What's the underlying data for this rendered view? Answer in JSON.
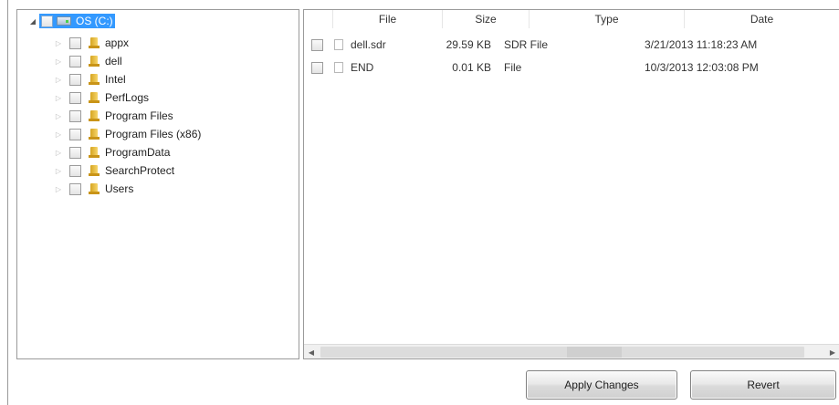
{
  "tree": {
    "root_label": "OS (C:)",
    "folders": [
      "appx",
      "dell",
      "Intel",
      "PerfLogs",
      "Program Files",
      "Program Files (x86)",
      "ProgramData",
      "SearchProtect",
      "Users"
    ]
  },
  "file_list": {
    "columns": [
      "File",
      "Size",
      "Type",
      "Date"
    ],
    "rows": [
      {
        "file": "dell.sdr",
        "size": "29.59 KB",
        "type": "SDR File",
        "date": "3/21/2013 11:18:23 AM"
      },
      {
        "file": "END",
        "size": "0.01 KB",
        "type": "File",
        "date": "10/3/2013 12:03:08 PM"
      }
    ]
  },
  "buttons": {
    "apply_label": "Apply Changes",
    "revert_label": "Revert"
  },
  "icons": {
    "expanded": "triangle-down-icon",
    "collapsed": "triangle-right-icon",
    "drive": "hard-drive-icon",
    "folder": "folder-icon",
    "file": "document-icon"
  }
}
